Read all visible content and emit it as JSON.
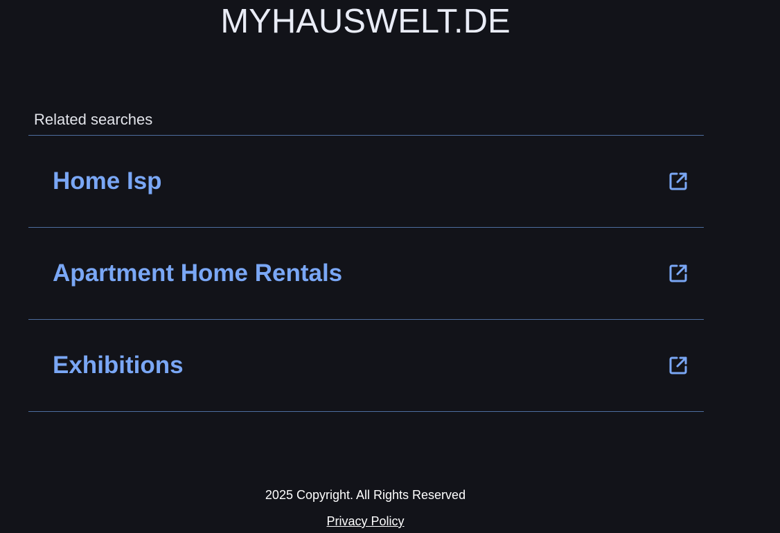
{
  "site": {
    "title": "MYHAUSWELT.DE"
  },
  "related": {
    "heading": "Related searches",
    "items": [
      {
        "label": "Home Isp",
        "icon": "external-link-icon"
      },
      {
        "label": "Apartment Home Rentals",
        "icon": "external-link-icon"
      },
      {
        "label": "Exhibitions",
        "icon": "external-link-icon"
      }
    ]
  },
  "footer": {
    "copyright": "2025 Copyright. All Rights Reserved",
    "privacy_label": "Privacy Policy"
  },
  "colors": {
    "background": "#121319",
    "accent": "#7aa7f5",
    "divider": "#4e6ea0"
  }
}
